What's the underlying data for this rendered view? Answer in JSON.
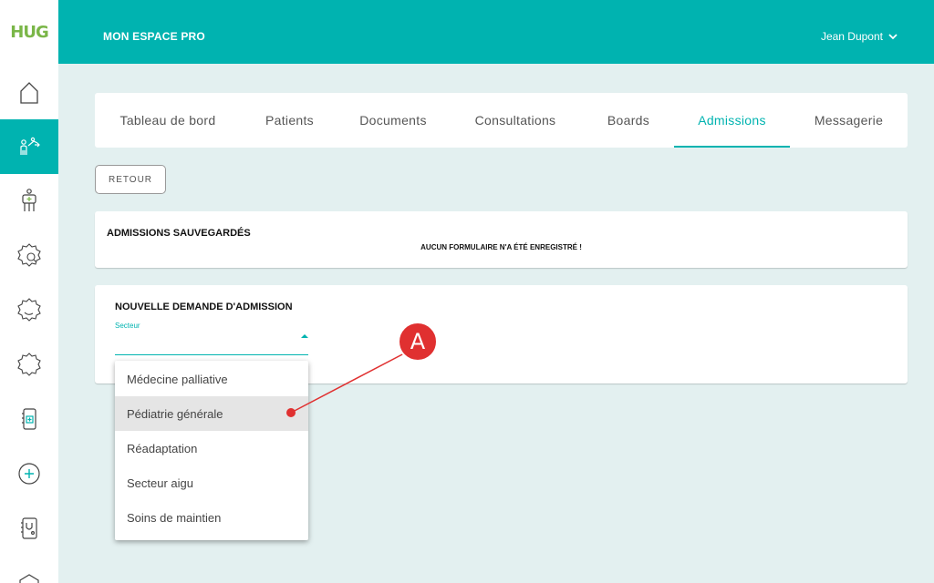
{
  "logo": {
    "text": "HUG",
    "color": "#7ab648"
  },
  "header": {
    "title": "MON ESPACE PRO",
    "user": "Jean Dupont",
    "user_icon": "chevron-down-icon",
    "bg": "#00b3b0"
  },
  "sidebar": {
    "items": [
      {
        "icon": "home-icon",
        "active": false
      },
      {
        "icon": "doctor-patient-icon",
        "active": true
      },
      {
        "icon": "patient-bed-icon",
        "active": false
      },
      {
        "icon": "search-gear-icon",
        "active": false
      },
      {
        "icon": "gear-moon-icon",
        "active": false
      },
      {
        "icon": "gear-icon",
        "active": false
      },
      {
        "icon": "document-add-icon",
        "active": false
      },
      {
        "icon": "add-circle-icon",
        "active": false
      },
      {
        "icon": "stethoscope-document-icon",
        "active": false
      },
      {
        "icon": "shield-icon",
        "active": false
      }
    ]
  },
  "tabs": [
    {
      "label": "Tableau de bord",
      "active": false
    },
    {
      "label": "Patients",
      "active": false
    },
    {
      "label": "Documents",
      "active": false
    },
    {
      "label": "Consultations",
      "active": false
    },
    {
      "label": "Boards",
      "active": false
    },
    {
      "label": "Admissions",
      "active": true
    },
    {
      "label": "Messagerie",
      "active": false
    }
  ],
  "back_button": "RETOUR",
  "saved": {
    "title": "ADMISSIONS SAUVEGARDÉS",
    "empty": "AUCUN FORMULAIRE N'A ÉTÉ ENREGISTRÉ !"
  },
  "new_request": {
    "title": "NOUVELLE DEMANDE D'ADMISSION",
    "field_label": "Secteur",
    "options": [
      "Médecine palliative",
      "Pédiatrie générale",
      "Réadaptation",
      "Secteur aigu",
      "Soins de maintien"
    ],
    "highlighted": "Pédiatrie générale"
  },
  "annotation": {
    "label": "A",
    "color": "#e03030"
  }
}
